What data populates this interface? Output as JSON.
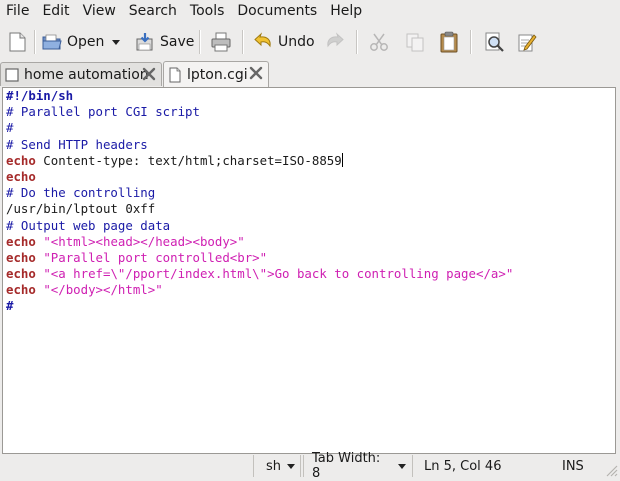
{
  "menu": [
    "File",
    "Edit",
    "View",
    "Search",
    "Tools",
    "Documents",
    "Help"
  ],
  "toolbar": {
    "open_label": "Open",
    "save_label": "Save",
    "undo_label": "Undo"
  },
  "tabs": [
    {
      "label": "home automation",
      "active": false
    },
    {
      "label": "lpton.cgi",
      "active": true
    }
  ],
  "editor": {
    "lines": [
      [
        {
          "t": "#!/bin/sh",
          "c": "comment bold"
        }
      ],
      [
        {
          "t": "# Parallel port CGI script",
          "c": "comment"
        }
      ],
      [
        {
          "t": "#",
          "c": "comment"
        }
      ],
      [
        {
          "t": "# Send HTTP headers",
          "c": "comment"
        }
      ],
      [
        {
          "t": "echo",
          "c": "kw"
        },
        {
          "t": " Content-type: text/html;charset=ISO-8859",
          "c": "plain"
        }
      ],
      [
        {
          "t": "echo",
          "c": "kw"
        }
      ],
      [
        {
          "t": "# Do the controlling",
          "c": "comment"
        }
      ],
      [
        {
          "t": "/usr/bin/lptout 0xff",
          "c": "plain"
        }
      ],
      [
        {
          "t": "# Output web page data",
          "c": "comment"
        }
      ],
      [
        {
          "t": "echo",
          "c": "kw"
        },
        {
          "t": " ",
          "c": "plain"
        },
        {
          "t": "\"<html><head></head><body>\"",
          "c": "str"
        }
      ],
      [
        {
          "t": "echo",
          "c": "kw"
        },
        {
          "t": " ",
          "c": "plain"
        },
        {
          "t": "\"Parallel port controlled<br>\"",
          "c": "str"
        }
      ],
      [
        {
          "t": "echo",
          "c": "kw"
        },
        {
          "t": " ",
          "c": "plain"
        },
        {
          "t": "\"<a href=\\\"/pport/index.html\\\">Go back to controlling page</a>\"",
          "c": "str"
        }
      ],
      [
        {
          "t": "echo",
          "c": "kw"
        },
        {
          "t": " ",
          "c": "plain"
        },
        {
          "t": "\"</body></html>\"",
          "c": "str"
        }
      ],
      [
        {
          "t": "#",
          "c": "comment bold"
        }
      ]
    ],
    "cursor_line": 5,
    "cursor_col": 46
  },
  "status": {
    "language": "sh",
    "tab_width": "Tab Width: 8",
    "position": "Ln 5, Col 46",
    "mode": "INS"
  }
}
